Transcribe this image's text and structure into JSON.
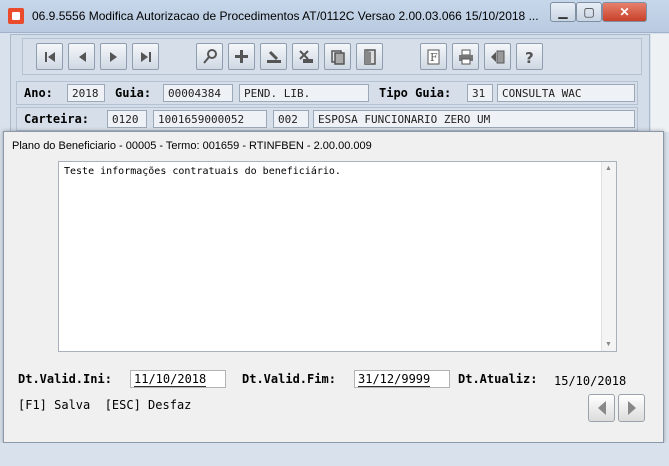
{
  "window": {
    "title": "06.9.5556  Modifica  Autorizacao de Procedimentos AT/0112C Versao 2.00.03.066 15/10/2018 ..."
  },
  "toolbar": {
    "buttons": [
      {
        "icon": "first-record-icon"
      },
      {
        "icon": "previous-record-icon"
      },
      {
        "icon": "next-record-icon"
      },
      {
        "icon": "last-record-icon"
      },
      {
        "icon": "search-key-icon"
      },
      {
        "icon": "add-record-icon"
      },
      {
        "icon": "edit-record-icon"
      },
      {
        "icon": "delete-record-icon"
      },
      {
        "icon": "copy-record-icon"
      },
      {
        "icon": "exit-door-icon"
      },
      {
        "icon": "filter-icon"
      },
      {
        "icon": "print-icon"
      },
      {
        "icon": "navigate-icon"
      },
      {
        "icon": "help-icon"
      }
    ]
  },
  "header": {
    "ano_label": "Ano:",
    "ano_value": "2018",
    "guia_label": "Guia:",
    "guia_value": "00004384",
    "status_value": "PEND. LIB.",
    "tipo_guia_label": "Tipo Guia:",
    "tipo_guia_code": "31",
    "tipo_guia_desc": "CONSULTA WAC",
    "carteira_label": "Carteira:",
    "carteira_1": "0120",
    "carteira_2": "1001659000052",
    "carteira_3": "002",
    "carteira_name": "ESPOSA FUNCIONARIO ZERO UM"
  },
  "dialog": {
    "title": "Plano do Beneficiario - 00005 - Termo: 001659 - RTINFBEN - 2.00.00.009",
    "memo_text": "Teste informações contratuais do beneficiário.",
    "dt_valid_ini_label": "Dt.Valid.Ini:",
    "dt_valid_ini_value": "11/10/2018",
    "dt_valid_fim_label": "Dt.Valid.Fim:",
    "dt_valid_fim_value": "31/12/9999",
    "dt_atualiz_label": "Dt.Atualiz:",
    "dt_atualiz_value": "15/10/2018",
    "shortcuts": "[F1] Salva  [ESC] Desfaz"
  },
  "colors": {
    "window_bg": "#d9e2ec",
    "close_button": "#c8412a",
    "dialog_bg": "#f0f0f0"
  }
}
